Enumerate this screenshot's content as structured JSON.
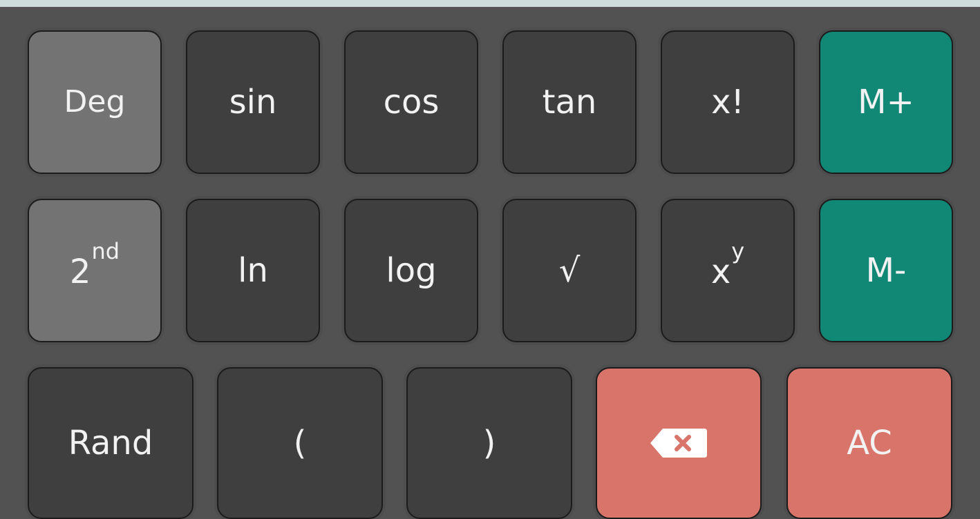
{
  "colors": {
    "panel": "#525252",
    "key": "#3f3f3f",
    "mode_key": "#737373",
    "memory_key": "#118776",
    "danger_key": "#d8746a",
    "text": "#f2f2f2"
  },
  "keys": {
    "deg": "Deg",
    "sin": "sin",
    "cos": "cos",
    "tan": "tan",
    "factorial": "x!",
    "m_plus": "M+",
    "second_base": "2",
    "second_sup": "nd",
    "ln": "ln",
    "log": "log",
    "sqrt": "√",
    "power_base": "x",
    "power_sup": "y",
    "m_minus": "M-",
    "rand": "Rand",
    "paren_open": "(",
    "paren_close": ")",
    "backspace_icon": "backspace-icon",
    "ac": "AC"
  }
}
